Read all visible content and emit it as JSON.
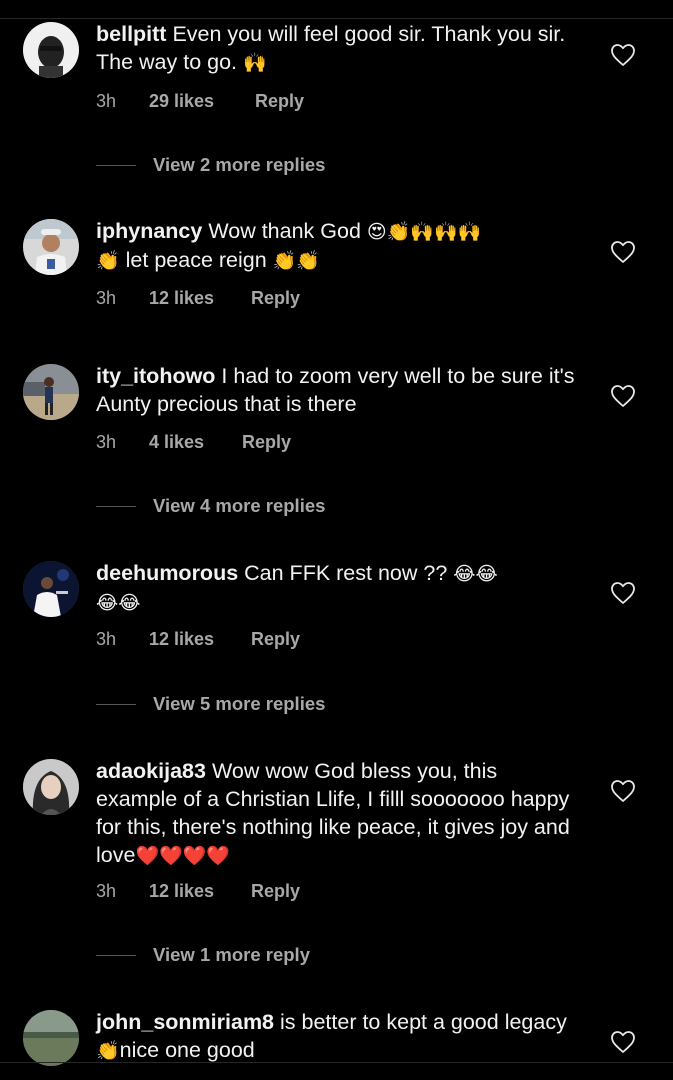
{
  "comments": [
    {
      "username": "bellpitt",
      "text": "Even you will feel good sir. Thank you sir. The way to go.",
      "emoji": "🙌",
      "time": "3h",
      "likes": "29 likes",
      "reply": "Reply",
      "view_more": "View 2 more replies"
    },
    {
      "username": "iphynancy",
      "text": "Wow thank God",
      "emoji": "😍👏🙌🙌🙌",
      "text2": "let peace reign",
      "emoji2": "👏👏",
      "lead_emoji2": "👏",
      "time": "3h",
      "likes": "12 likes",
      "reply": "Reply"
    },
    {
      "username": "ity_itohowo",
      "text": "I had to zoom very well to be sure it's Aunty precious that is there",
      "time": "3h",
      "likes": "4 likes",
      "reply": "Reply",
      "view_more": "View 4 more replies"
    },
    {
      "username": "deehumorous",
      "text": "Can FFK rest now ??",
      "emoji": "😂😂",
      "emoji2": "😂😂",
      "time": "3h",
      "likes": "12 likes",
      "reply": "Reply",
      "view_more": "View 5 more replies"
    },
    {
      "username": "adaokija83",
      "text": "Wow wow God bless you, this example of a Christian Llife, I filll sooooooo happy for this, there's nothing like peace, it gives joy and love",
      "emoji": "❤️❤️❤️❤️",
      "time": "3h",
      "likes": "12 likes",
      "reply": "Reply",
      "view_more": "View 1 more reply"
    },
    {
      "username": "john_sonmiriam8",
      "text": "is better to kept a good legacy",
      "emoji": "👏",
      "text2": "nice one good"
    }
  ],
  "colors": {
    "background": "#000000",
    "text": "#f2f2f2",
    "muted": "#a8a8a8"
  },
  "icons": {
    "heart": "heart-outline-icon"
  }
}
